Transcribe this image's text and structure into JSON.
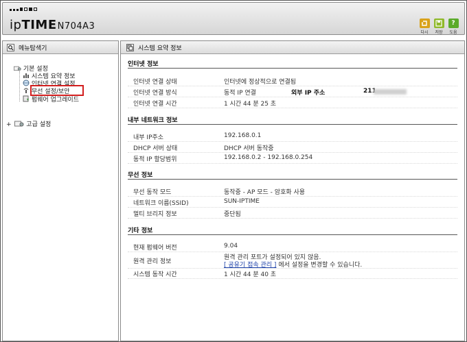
{
  "header": {
    "logo_ip": "ip",
    "logo_time": "TIME",
    "model": "N704A3",
    "tools": [
      {
        "label": "다시",
        "icon": "refresh-icon",
        "color": "#d9a21b"
      },
      {
        "label": "저장",
        "icon": "save-icon",
        "color": "#8fb92a"
      },
      {
        "label": "도움",
        "icon": "help-icon",
        "color": "#5bab2a"
      }
    ]
  },
  "sidebar": {
    "title": "메뉴탐색기",
    "basic_label": "기본 설정",
    "items": [
      {
        "label": "시스템 요약 정보"
      },
      {
        "label": "인터넷 연결 설정"
      },
      {
        "label": "무선 설정/보안"
      },
      {
        "label": "펌웨어 업그레이드"
      }
    ],
    "advanced_expander": "+",
    "advanced_label": "고급 설정"
  },
  "main": {
    "title": "시스템 요약 정보",
    "sections": {
      "internet": {
        "title": "인터넷 정보",
        "rows": [
          {
            "label": "인터넷 연결 상태",
            "value": "인터넷에 정상적으로 연결됨"
          },
          {
            "label": "인터넷 연결 방식",
            "value": "동적 IP 연결",
            "label2": "외부 IP 주소",
            "value2": "211"
          },
          {
            "label": "인터넷 연결 시간",
            "value": "1 시간 44 분 25 초"
          }
        ]
      },
      "lan": {
        "title": "내부 네트워크 정보",
        "rows": [
          {
            "label": "내부 IP주소",
            "value": "192.168.0.1"
          },
          {
            "label": "DHCP 서버 상태",
            "value": "DHCP 서버 동작중"
          },
          {
            "label": "동적 IP 할당범위",
            "value": "192.168.0.2 -  192.168.0.254"
          }
        ]
      },
      "wireless": {
        "title": "무선 정보",
        "rows": [
          {
            "label": "무선 동작 모드",
            "value": "동작중 - AP 모드 - 암호화 사용"
          },
          {
            "label": "네트워크 이름(SSID)",
            "value": "SUN-IPTIME"
          },
          {
            "label": "멀티 브리지 정보",
            "value": "중단됨"
          }
        ]
      },
      "other": {
        "title": "기타 정보",
        "rows": [
          {
            "label": "현재 펌웨어 버전",
            "value": "9.04"
          },
          {
            "label": "원격 관리 정보",
            "value_line1": "원격 관리 포트가 설정되어 있지 않음.",
            "link": "[ 공유기 접속 관리 ]",
            "value_line2_suffix": "에서 설정을 변경할 수 있습니다."
          },
          {
            "label": "시스템 동작 시간",
            "value": "1 시간 44 분 40 초"
          }
        ]
      }
    }
  }
}
